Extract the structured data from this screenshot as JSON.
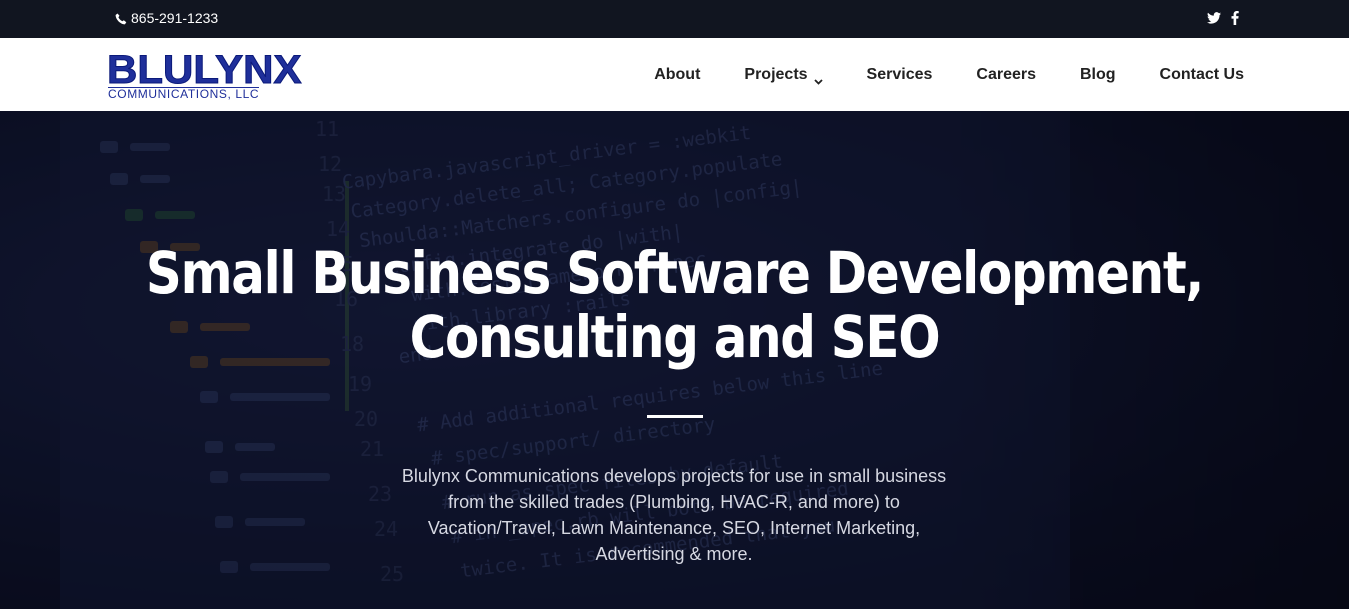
{
  "topbar": {
    "phone": "865-291-1233",
    "social_icons": [
      "twitter-icon",
      "facebook-icon"
    ]
  },
  "header": {
    "logo_main": "BLULYNX",
    "logo_sub": "COMMUNICATIONS, LLC",
    "nav": [
      {
        "label": "About"
      },
      {
        "label": "Projects",
        "has_dropdown": true
      },
      {
        "label": "Services"
      },
      {
        "label": "Careers"
      },
      {
        "label": "Blog"
      },
      {
        "label": "Contact Us"
      }
    ]
  },
  "hero": {
    "title_line1": "Small Business Software Development,",
    "title_line2": "Consulting and SEO",
    "description_lines": [
      "Blulynx Communications develops projects for use in small business",
      "from the skilled trades (Plumbing, HVAC-R, and more) to",
      "Vacation/Travel, Lawn Maintenance, SEO, Internet Marketing,",
      "Advertising & more."
    ]
  },
  "colors": {
    "topbar_bg": "#111520",
    "brand_blue": "#1f2f9a",
    "hero_bg": "#121833"
  }
}
